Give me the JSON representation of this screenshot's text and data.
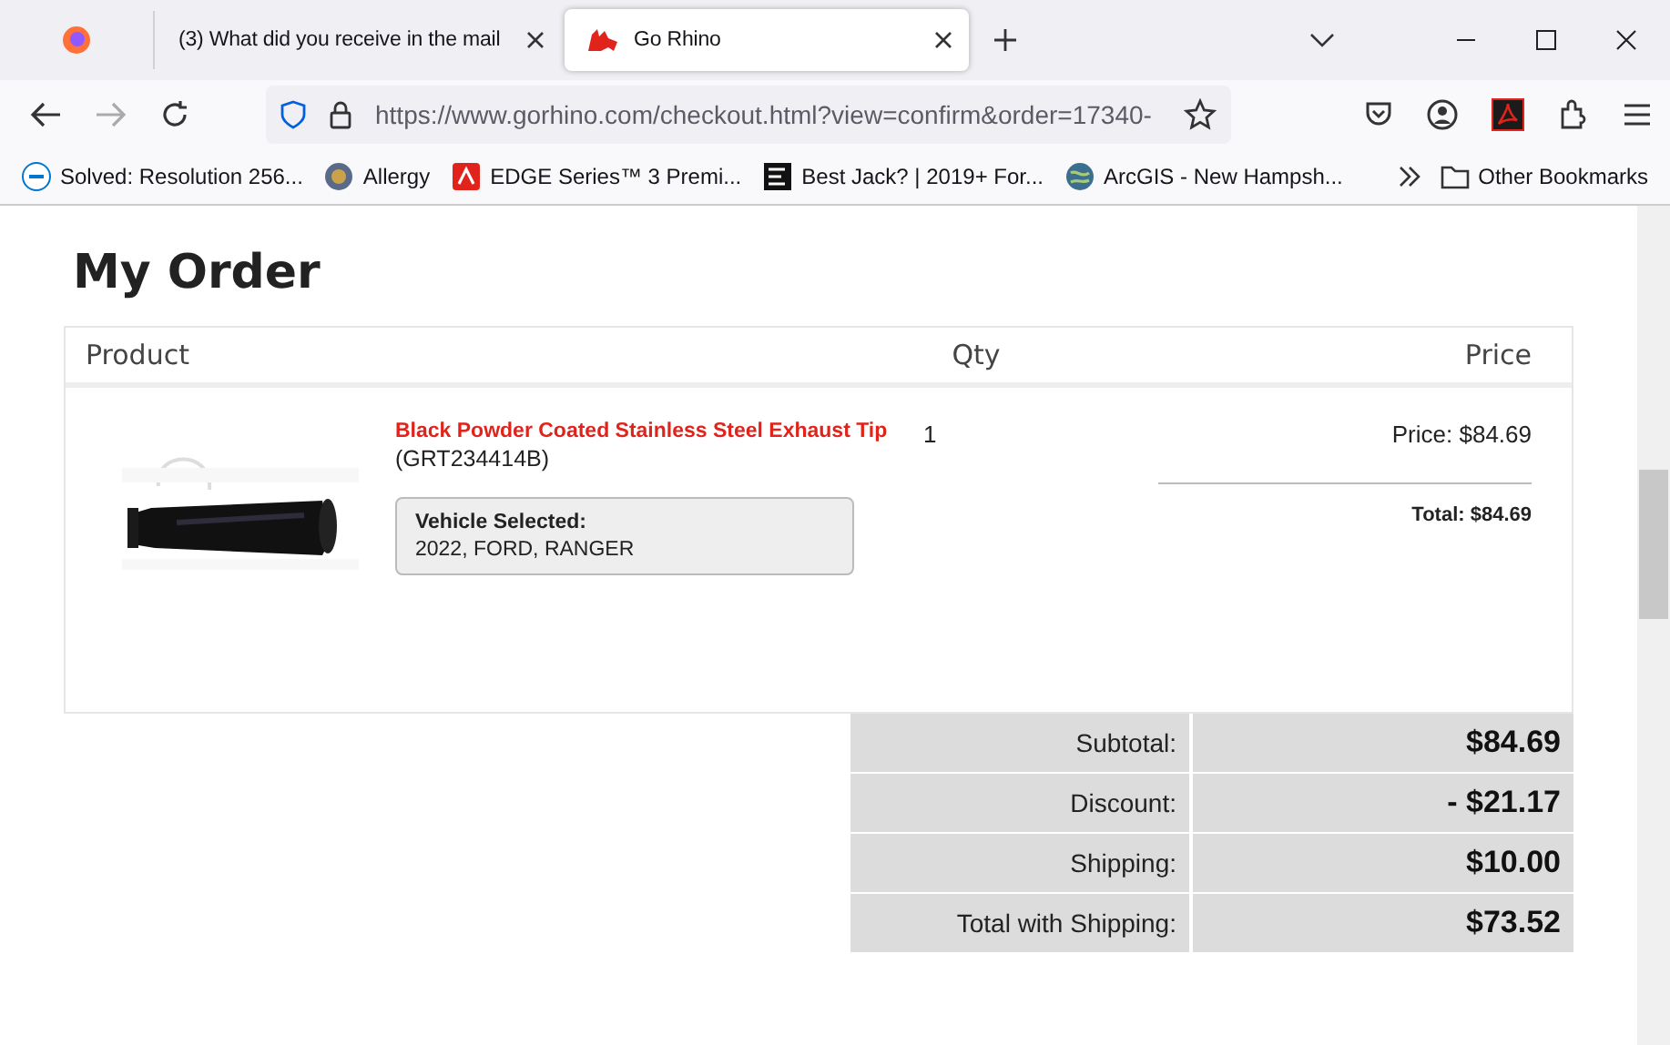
{
  "tabs": [
    {
      "title": "(3) What did you receive in the mail",
      "selected": false
    },
    {
      "title": "Go Rhino",
      "selected": true
    }
  ],
  "toolbar": {
    "url": "https://www.gorhino.com/checkout.html?view=confirm&order=17340-"
  },
  "bookmarks": [
    {
      "label": "Solved: Resolution 256..."
    },
    {
      "label": "Allergy"
    },
    {
      "label": "EDGE Series™ 3 Premi..."
    },
    {
      "label": "Best Jack? | 2019+ For..."
    },
    {
      "label": "ArcGIS - New Hampsh..."
    }
  ],
  "other_bookmarks": "Other Bookmarks",
  "page": {
    "heading": "My Order",
    "columns": [
      "Product",
      "Qty",
      "Price"
    ],
    "item": {
      "name": "Black Powder Coated Stainless Steel Exhaust Tip",
      "sku": "(GRT234414B)",
      "vehicle_label": "Vehicle Selected:",
      "vehicle": "2022, FORD, RANGER",
      "qty": "1",
      "price": "Price: $84.69",
      "total": "Total: $84.69"
    },
    "summary": [
      {
        "label": "Subtotal:",
        "value": "$84.69"
      },
      {
        "label": "Discount:",
        "value": "- $21.17"
      },
      {
        "label": "Shipping:",
        "value": "$10.00"
      },
      {
        "label": "Total with Shipping:",
        "value": "$73.52"
      }
    ]
  }
}
